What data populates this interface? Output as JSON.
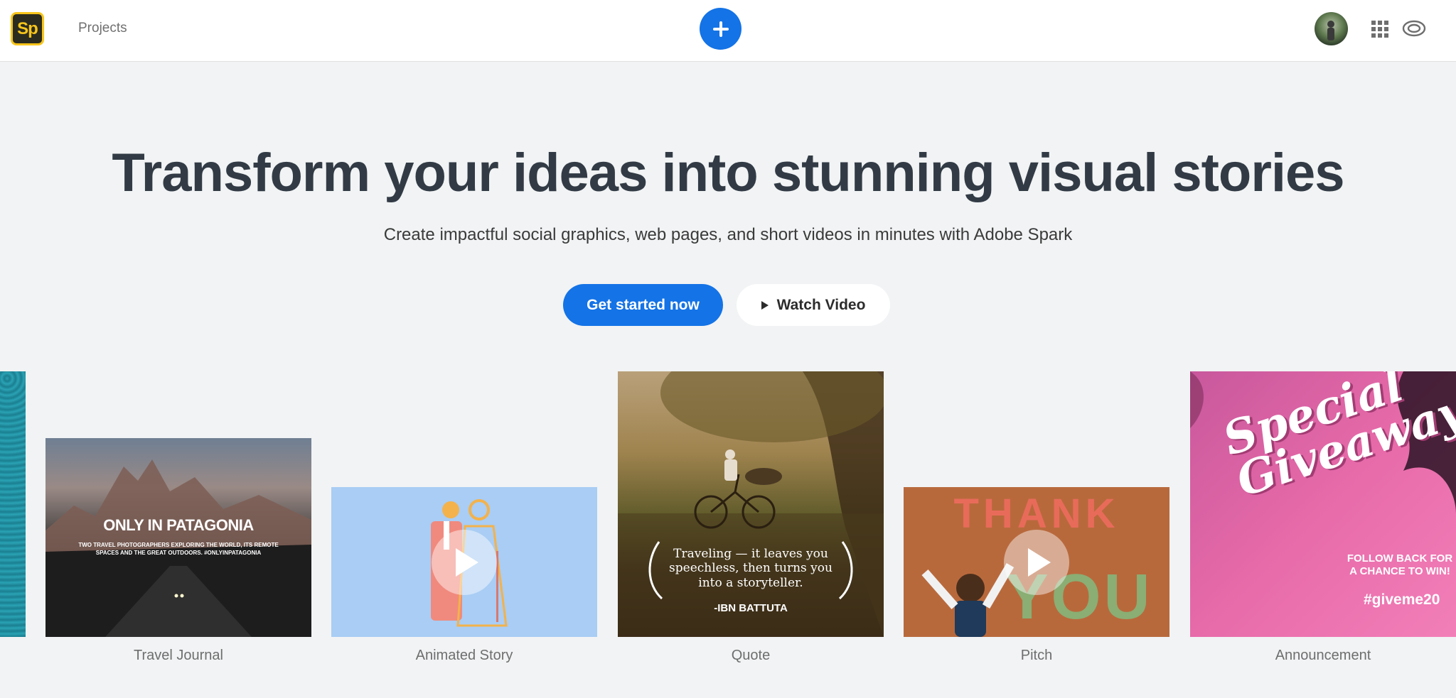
{
  "header": {
    "logo_text": "Sp",
    "nav_projects": "Projects"
  },
  "hero": {
    "title": "Transform your ideas into stunning visual stories",
    "subtitle": "Create impactful social graphics, web pages, and short videos in minutes with Adobe Spark",
    "primary_button": "Get started now",
    "secondary_button": "Watch Video"
  },
  "cards": [
    {
      "label": "Travel Journal",
      "title": "ONLY IN PATAGONIA",
      "subtitle": "TWO TRAVEL PHOTOGRAPHERS EXPLORING THE WORLD, ITS REMOTE SPACES AND THE GREAT OUTDOORS. #ONLYINPATAGONIA"
    },
    {
      "label": "Animated Story"
    },
    {
      "label": "Quote",
      "quote": "Traveling — it leaves you speechless, then turns you into a storyteller.",
      "author": "-IBN BATTUTA"
    },
    {
      "label": "Pitch",
      "word1": "THANK",
      "word2": "YOU"
    },
    {
      "label": "Announcement",
      "title_line1": "Special",
      "title_line2": "Giveaway",
      "follow_line1": "FOLLOW BACK FOR",
      "follow_line2": "A CHANCE TO WIN!",
      "hashtag": "#giveme20"
    }
  ],
  "colors": {
    "accent": "#1473e6",
    "logo_yellow": "#f7c51b",
    "page_background": "#f1f3f4",
    "title_text": "#323b45"
  },
  "icons": {
    "create": "plus-icon",
    "apps": "app-grid-icon",
    "creative_cloud": "creative-cloud-icon",
    "play": "play-icon"
  }
}
